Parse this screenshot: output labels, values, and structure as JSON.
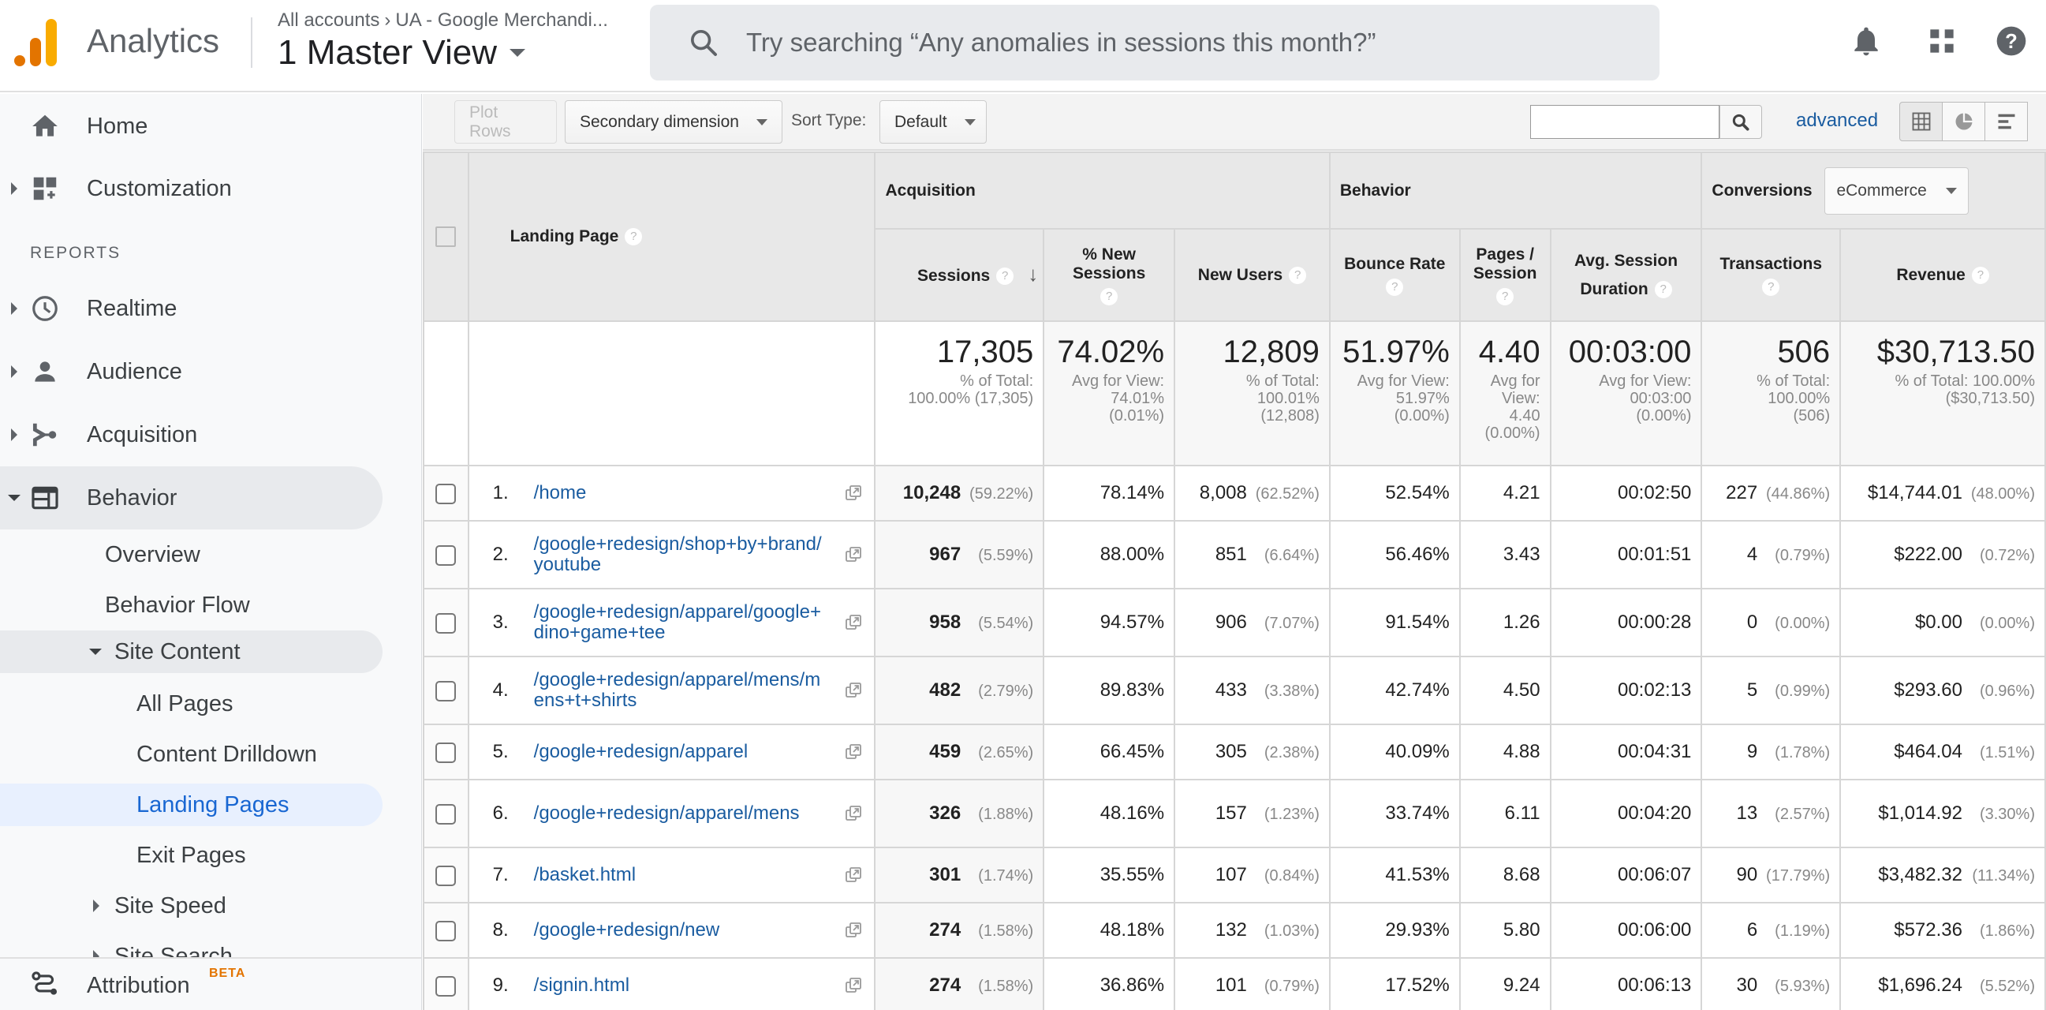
{
  "header": {
    "app_name": "Analytics",
    "breadcrumb": [
      "All accounts",
      "UA - Google Merchandi..."
    ],
    "view_name": "1 Master View",
    "search_placeholder": "Try searching “Any anomalies in sessions this month?”",
    "icons": [
      "notifications-bell-icon",
      "apps-grid-icon",
      "help-icon"
    ]
  },
  "sidebar": {
    "top_items": [
      {
        "label": "Home",
        "icon": "home-icon"
      },
      {
        "label": "Customization",
        "icon": "dashboard-add-icon"
      }
    ],
    "section_label": "REPORTS",
    "report_items": [
      {
        "label": "Realtime",
        "icon": "clock-icon"
      },
      {
        "label": "Audience",
        "icon": "person-icon"
      },
      {
        "label": "Acquisition",
        "icon": "acquisition-icon"
      },
      {
        "label": "Behavior",
        "icon": "behavior-icon"
      }
    ],
    "behavior_children": [
      "Overview",
      "Behavior Flow",
      "Site Content",
      "Site Speed",
      "Site Search"
    ],
    "site_content_children": [
      "All Pages",
      "Content Drilldown",
      "Landing Pages",
      "Exit Pages"
    ],
    "selected": "Landing Pages",
    "bottom_item": {
      "label": "Attribution",
      "badge": "BETA"
    }
  },
  "toolbar": {
    "plot_rows": "Plot Rows",
    "secondary_dimension": "Secondary dimension",
    "sort_type_label": "Sort Type:",
    "sort_type_value": "Default",
    "search_value": "",
    "advanced": "advanced",
    "views": [
      "table-view-icon",
      "pie-view-icon",
      "performance-view-icon"
    ]
  },
  "table": {
    "groups": {
      "acquisition": "Acquisition",
      "behavior": "Behavior",
      "conversions": "Conversions",
      "conversions_select": "eCommerce"
    },
    "columns": {
      "landing_page": "Landing Page",
      "sessions": "Sessions",
      "pct_new_sessions_1": "% New",
      "pct_new_sessions_2": "Sessions",
      "new_users": "New Users",
      "bounce_rate": "Bounce Rate",
      "pages_session_1": "Pages /",
      "pages_session_2": "Session",
      "avg_duration_1": "Avg. Session",
      "avg_duration_2": "Duration",
      "transactions": "Transactions",
      "revenue": "Revenue"
    },
    "totals": {
      "sessions": {
        "value": "17,305",
        "sub": [
          "% of Total:",
          "100.00% (17,305)"
        ]
      },
      "pct_new": {
        "value": "74.02%",
        "sub": [
          "Avg for View:",
          "74.01%",
          "(0.01%)"
        ]
      },
      "new_users": {
        "value": "12,809",
        "sub": [
          "% of Total:",
          "100.01%",
          "(12,808)"
        ]
      },
      "bounce": {
        "value": "51.97%",
        "sub": [
          "Avg for View:",
          "51.97%",
          "(0.00%)"
        ]
      },
      "pages": {
        "value": "4.40",
        "sub": [
          "Avg for",
          "View:",
          "4.40",
          "(0.00%)"
        ]
      },
      "duration": {
        "value": "00:03:00",
        "sub": [
          "Avg for View:",
          "00:03:00",
          "(0.00%)"
        ]
      },
      "transactions": {
        "value": "506",
        "sub": [
          "% of Total:",
          "100.00%",
          "(506)"
        ]
      },
      "revenue": {
        "value": "$30,713.50",
        "sub": [
          "% of Total: 100.00%",
          "($30,713.50)"
        ]
      }
    },
    "rows": [
      {
        "idx": "1.",
        "page": "/home",
        "sessions": "10,248",
        "sessions_pct": "(59.22%)",
        "pct_new": "78.14%",
        "new_users": "8,008",
        "new_users_pct": "(62.52%)",
        "bounce": "52.54%",
        "pages": "4.21",
        "duration": "00:02:50",
        "transactions": "227",
        "transactions_pct": "(44.86%)",
        "revenue": "$14,744.01",
        "revenue_pct": "(48.00%)"
      },
      {
        "idx": "2.",
        "page": "/google+redesign/shop+by+brand/youtube",
        "sessions": "967",
        "sessions_pct": "(5.59%)",
        "pct_new": "88.00%",
        "new_users": "851",
        "new_users_pct": "(6.64%)",
        "bounce": "56.46%",
        "pages": "3.43",
        "duration": "00:01:51",
        "transactions": "4",
        "transactions_pct": "(0.79%)",
        "revenue": "$222.00",
        "revenue_pct": "(0.72%)"
      },
      {
        "idx": "3.",
        "page": "/google+redesign/apparel/google+dino+game+tee",
        "sessions": "958",
        "sessions_pct": "(5.54%)",
        "pct_new": "94.57%",
        "new_users": "906",
        "new_users_pct": "(7.07%)",
        "bounce": "91.54%",
        "pages": "1.26",
        "duration": "00:00:28",
        "transactions": "0",
        "transactions_pct": "(0.00%)",
        "revenue": "$0.00",
        "revenue_pct": "(0.00%)"
      },
      {
        "idx": "4.",
        "page": "/google+redesign/apparel/mens/mens+t+shirts",
        "sessions": "482",
        "sessions_pct": "(2.79%)",
        "pct_new": "89.83%",
        "new_users": "433",
        "new_users_pct": "(3.38%)",
        "bounce": "42.74%",
        "pages": "4.50",
        "duration": "00:02:13",
        "transactions": "5",
        "transactions_pct": "(0.99%)",
        "revenue": "$293.60",
        "revenue_pct": "(0.96%)"
      },
      {
        "idx": "5.",
        "page": "/google+redesign/apparel",
        "sessions": "459",
        "sessions_pct": "(2.65%)",
        "pct_new": "66.45%",
        "new_users": "305",
        "new_users_pct": "(2.38%)",
        "bounce": "40.09%",
        "pages": "4.88",
        "duration": "00:04:31",
        "transactions": "9",
        "transactions_pct": "(1.78%)",
        "revenue": "$464.04",
        "revenue_pct": "(1.51%)"
      },
      {
        "idx": "6.",
        "page": "/google+redesign/apparel/mens",
        "sessions": "326",
        "sessions_pct": "(1.88%)",
        "pct_new": "48.16%",
        "new_users": "157",
        "new_users_pct": "(1.23%)",
        "bounce": "33.74%",
        "pages": "6.11",
        "duration": "00:04:20",
        "transactions": "13",
        "transactions_pct": "(2.57%)",
        "revenue": "$1,014.92",
        "revenue_pct": "(3.30%)"
      },
      {
        "idx": "7.",
        "page": "/basket.html",
        "sessions": "301",
        "sessions_pct": "(1.74%)",
        "pct_new": "35.55%",
        "new_users": "107",
        "new_users_pct": "(0.84%)",
        "bounce": "41.53%",
        "pages": "8.68",
        "duration": "00:06:07",
        "transactions": "90",
        "transactions_pct": "(17.79%)",
        "revenue": "$3,482.32",
        "revenue_pct": "(11.34%)"
      },
      {
        "idx": "8.",
        "page": "/google+redesign/new",
        "sessions": "274",
        "sessions_pct": "(1.58%)",
        "pct_new": "48.18%",
        "new_users": "132",
        "new_users_pct": "(1.03%)",
        "bounce": "29.93%",
        "pages": "5.80",
        "duration": "00:06:00",
        "transactions": "6",
        "transactions_pct": "(1.19%)",
        "revenue": "$572.36",
        "revenue_pct": "(1.86%)"
      },
      {
        "idx": "9.",
        "page": "/signin.html",
        "sessions": "274",
        "sessions_pct": "(1.58%)",
        "pct_new": "36.86%",
        "new_users": "101",
        "new_users_pct": "(0.79%)",
        "bounce": "17.52%",
        "pages": "9.24",
        "duration": "00:06:13",
        "transactions": "30",
        "transactions_pct": "(5.93%)",
        "revenue": "$1,696.24",
        "revenue_pct": "(5.52%)"
      }
    ]
  },
  "colors": {
    "brand_orange": "#e37400",
    "brand_yellow": "#f9ab00",
    "link_blue": "#1a5ca0",
    "selected_nav_bg": "#e8f0fe",
    "selected_nav_text": "#1967d2",
    "beta_badge": "#e37400"
  }
}
